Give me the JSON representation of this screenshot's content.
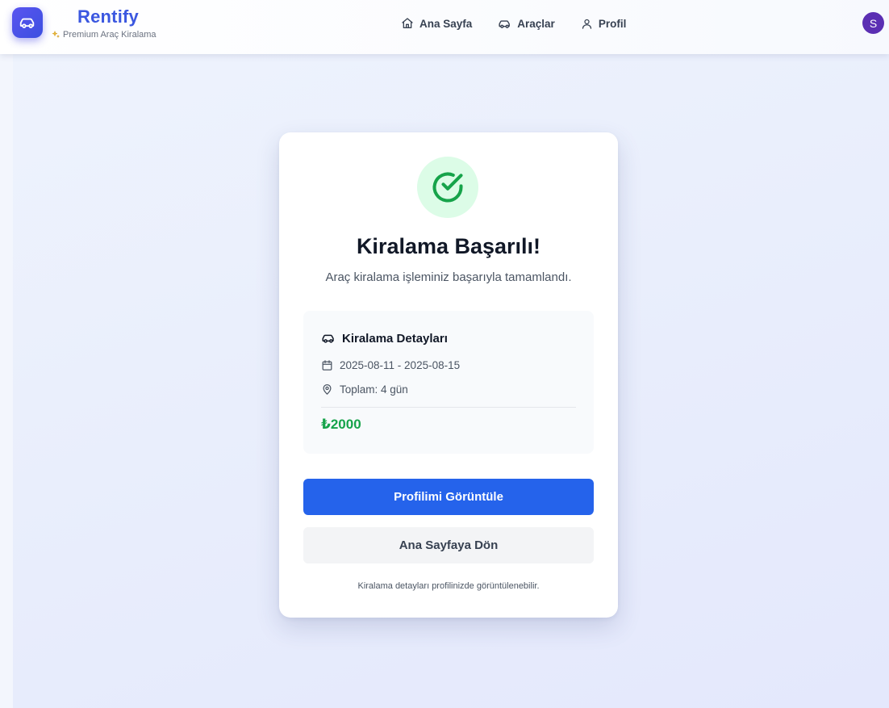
{
  "header": {
    "brand_name": "Rentify",
    "brand_tagline": "Premium Araç Kiralama",
    "brand_logo_icon": "car-icon",
    "tagline_icon": "sparkles-icon",
    "nav": [
      {
        "label": "Ana Sayfa",
        "icon": "home-icon"
      },
      {
        "label": "Araçlar",
        "icon": "car-icon"
      },
      {
        "label": "Profil",
        "icon": "user-icon"
      }
    ],
    "avatar_initial": "S"
  },
  "success_card": {
    "status_icon": "check-circle-icon",
    "title": "Kiralama Başarılı!",
    "subtitle": "Araç kiralama işleminiz başarıyla tamamlandı.",
    "details": {
      "heading": "Kiralama Detayları",
      "date_range": "2025-08-11 - 2025-08-15",
      "total_duration": "Toplam: 4 gün",
      "price": "₺2000"
    },
    "primary_button_label": "Profilimi Görüntüle",
    "secondary_button_label": "Ana Sayfaya Dön",
    "footnote": "Kiralama detayları profilinizde görüntülenebilir."
  },
  "colors": {
    "brand": "#3b57e0",
    "primary_button": "#2563eb",
    "success": "#16a34a",
    "success_bg": "#dcfce7",
    "avatar": "#5b2fb3"
  }
}
